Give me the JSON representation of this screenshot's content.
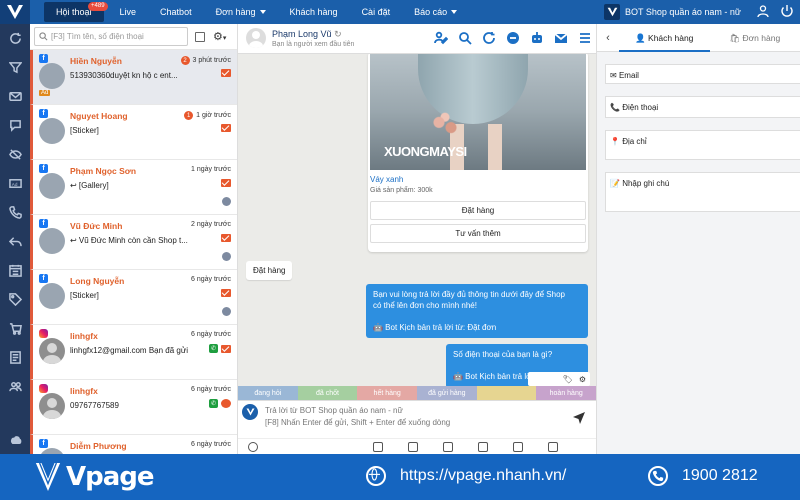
{
  "topnav": {
    "items": [
      {
        "label": "Hội thoại",
        "badge": "+489",
        "active": true
      },
      {
        "label": "Live"
      },
      {
        "label": "Chatbot"
      },
      {
        "label": "Đơn hàng",
        "dropdown": true
      },
      {
        "label": "Khách hàng"
      },
      {
        "label": "Cài đặt"
      },
      {
        "label": "Báo cáo",
        "dropdown": true
      }
    ],
    "shop_name": "BOT Shop quần áo nam - nữ"
  },
  "sidebar": {
    "icons": [
      "refresh-icon",
      "filter-icon",
      "inbox-icon",
      "comment-icon",
      "hidden-icon",
      "ad-icon",
      "phone-icon",
      "reply-icon",
      "calendar-icon",
      "tag-icon",
      "cart-icon",
      "report-icon",
      "users-icon"
    ],
    "bottom_icon": "cloud-icon"
  },
  "search": {
    "placeholder": "[F3] Tìm tên, số điện thoại"
  },
  "conversations": [
    {
      "name": "Hiền Nguyễn",
      "time": "3 phút trước",
      "count": "2",
      "preview": "513930360duyệt kn hộ c ent...",
      "source": "fb",
      "ad": "Ad",
      "selected": true,
      "unread": true
    },
    {
      "name": "Nguyet Hoang",
      "time": "1 giờ trước",
      "count": "1",
      "preview": "[Sticker]",
      "source": "fb",
      "unread": true
    },
    {
      "name": "Phạm Ngọc Sơn",
      "time": "1 ngày trước",
      "preview": "↩ [Gallery]",
      "source": "fb",
      "unread": true
    },
    {
      "name": "Vũ Đức Minh",
      "time": "2 ngày trước",
      "preview": "↩ Vũ Đức Minh còn cần Shop t...",
      "source": "fb",
      "unread": true
    },
    {
      "name": "Long Nguyễn",
      "time": "6 ngày trước",
      "preview": "[Sticker]",
      "source": "fb",
      "unread": true
    },
    {
      "name": "linhgfx",
      "time": "6 ngày trước",
      "preview": "linhgfx12@gmail.com Bạn đã gửi",
      "source": "ig",
      "unread": true
    },
    {
      "name": "linhgfx",
      "time": "6 ngày trước",
      "preview": "09767767589",
      "source": "ig",
      "unread": true
    },
    {
      "name": "Diễm Phương",
      "time": "6 ngày trước",
      "preview": "",
      "source": "fb",
      "unread": true
    }
  ],
  "chat": {
    "contact_name": "Phạm Long Vũ",
    "contact_sub": "Bạn là người xem đầu tiên",
    "product": {
      "watermark": "XUONGMAYSI",
      "title": "Váy xanh",
      "price": "Giá sản phẩm: 300k",
      "buttons": [
        "Đặt hàng",
        "Tư vấn thêm"
      ]
    },
    "incoming": "Đặt hàng",
    "outgoing": [
      {
        "lines": [
          "Bạn vui lòng trả lời đầy đủ thông tin dưới đây để Shop",
          "có thể lên đơn cho mình nhé!",
          "",
          "🤖 Bot Kịch bản trả lời từ: Đặt đơn"
        ]
      },
      {
        "lines": [
          "Số điện thoại của bạn là gì?",
          "",
          "🤖 Bot Kịch bản trả lời từ: Đặt đơn"
        ]
      }
    ]
  },
  "tags": [
    {
      "label": "đang hỏi",
      "color": "#9ab7d6"
    },
    {
      "label": "đã chốt",
      "color": "#a5cfa0"
    },
    {
      "label": "hết hàng",
      "color": "#e4a8a4"
    },
    {
      "label": "đã gửi hàng",
      "color": "#a9b2d2"
    },
    {
      "label": "",
      "color": "#e6d591"
    },
    {
      "label": "hoàn hàng",
      "color": "#c7a3cc"
    }
  ],
  "input": {
    "placeholder1": "Trả lời từ BOT Shop quần áo nam - nữ",
    "placeholder2": "[F8] Nhấn Enter để gửi, Shift + Enter để xuống dòng"
  },
  "right_panel": {
    "tabs": [
      "Khách hàng",
      "Đơn hàng"
    ],
    "fields": [
      "Email",
      "Điện thoại",
      "Địa chỉ",
      "Nhập ghi chú"
    ]
  },
  "footer": {
    "brand": "Vpage",
    "website": "https://vpage.nhanh.vn/",
    "phone": "1900 2812"
  },
  "colors": {
    "topbar": "#1b5faa",
    "sidebar": "#23395d",
    "accent_orange": "#e0622d",
    "bubble_blue": "#2d8fe0",
    "footer": "#1565c0"
  }
}
